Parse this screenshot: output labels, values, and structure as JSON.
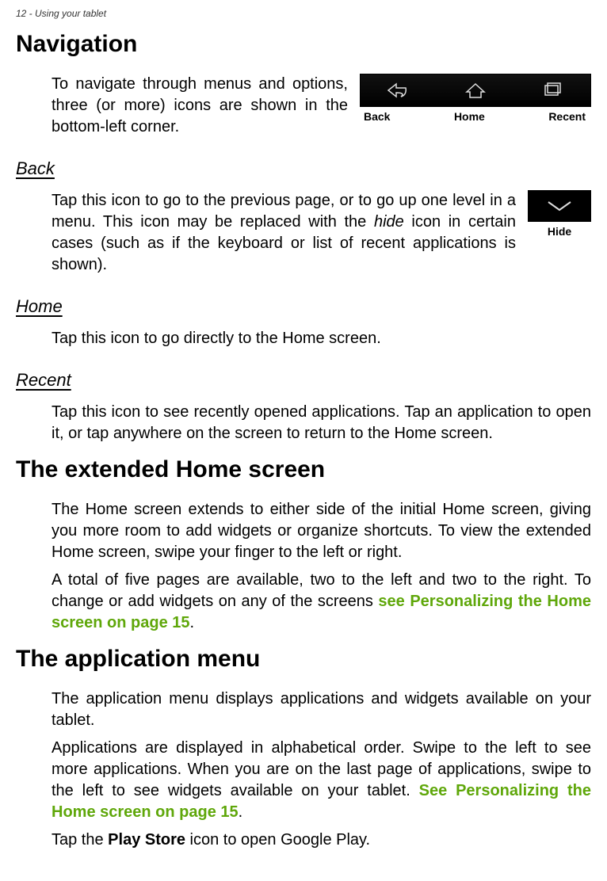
{
  "header": "12 - Using your tablet",
  "h1_navigation": "Navigation",
  "nav_intro": "To navigate through menus and options, three (or more) icons are shown in the bottom-left corner.",
  "navbar": {
    "back": "Back",
    "home": "Home",
    "recent": "Recent"
  },
  "back_heading": "Back",
  "back_text_pre": "Tap this icon to go to the previous page, or to go up one level in a menu. This icon may be replaced with the ",
  "back_hide_word": "hide",
  "back_text_post": " icon in certain cases (such as if the keyboard or list of recent applications is shown).",
  "hide_label": "Hide",
  "home_heading": "Home",
  "home_text": "Tap this icon to go directly to the Home screen.",
  "recent_heading": "Recent",
  "recent_text": "Tap this icon to see recently opened applications. Tap an application to open it, or tap anywhere on the screen to return to the Home screen.",
  "h1_extended": "The extended Home screen",
  "extended_p1": "The Home screen extends to either side of the initial Home screen, giving you more room to add widgets or organize shortcuts. To view the extended Home screen, swipe your finger to the left or right.",
  "extended_p2_pre": "A total of five pages are available, two to the left and two to the right. To change or add widgets on any of the screens ",
  "extended_link": "see Personalizing the Home screen on page 15",
  "extended_p2_post": ".",
  "h1_appmenu": "The application menu",
  "app_p1": "The application menu displays applications and widgets available on your tablet.",
  "app_p2_pre": "Applications are displayed in alphabetical order. Swipe to the left to see more applications. When you are on the last page of applications, swipe to the left to see widgets available on your tablet. ",
  "app_link": "See Personalizing the Home screen on page 15",
  "app_p2_post": ".",
  "app_p3_pre": "Tap the ",
  "app_p3_bold": "Play Store",
  "app_p3_post": " icon to open Google Play."
}
